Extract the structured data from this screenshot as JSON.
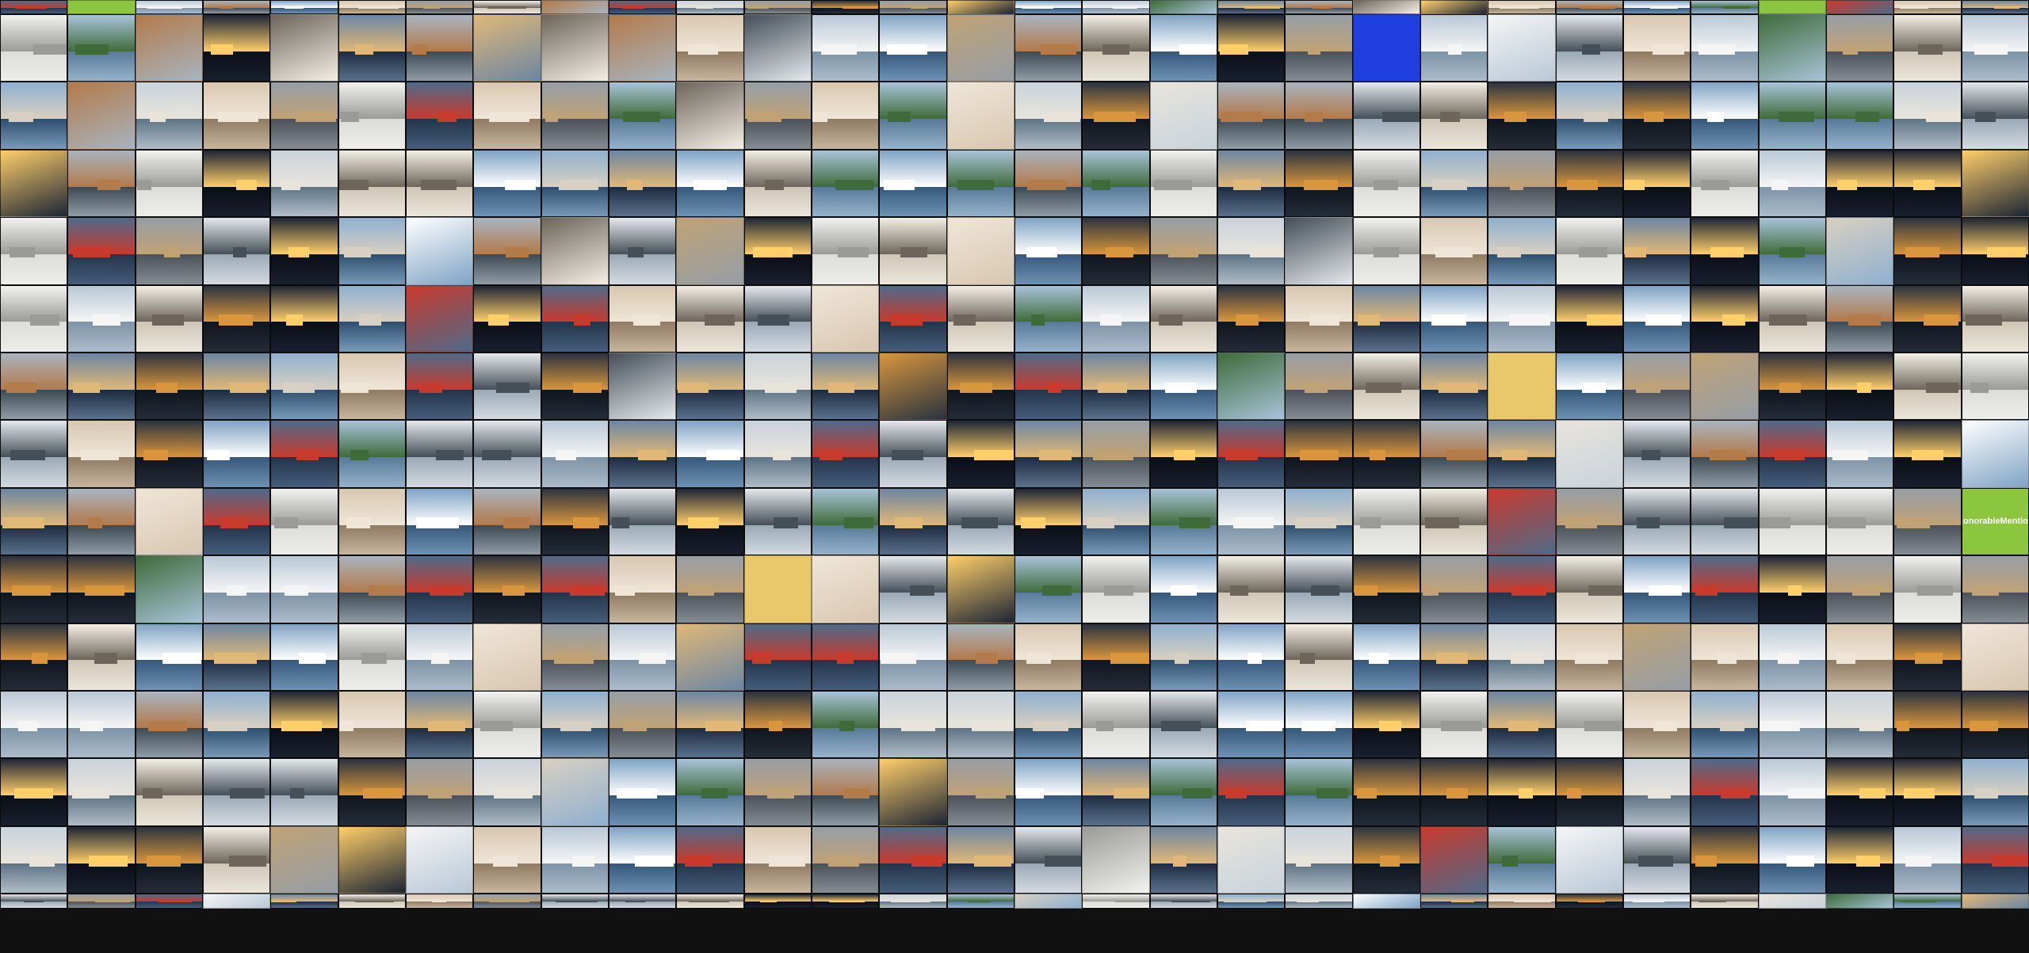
{
  "mosaic": {
    "columns": 30,
    "rows": 15,
    "palettes": [
      [
        "#c9d3dc",
        "#5d7384",
        "#e8e4dc"
      ],
      [
        "#8fb0cf",
        "#2d4f6d",
        "#d8d0c2"
      ],
      [
        "#a8b4bf",
        "#3e4a52",
        "#b37a4a"
      ],
      [
        "#f2f2f0",
        "#dcdcd8",
        "#9a9a96"
      ],
      [
        "#6c86a3",
        "#1c2b3f",
        "#e0b878"
      ],
      [
        "#2a3340",
        "#0f151d",
        "#d9963c"
      ],
      [
        "#b9c8d6",
        "#7d93a6",
        "#f5f5f5"
      ],
      [
        "#d8c7b0",
        "#8f7a62",
        "#efe6d8"
      ],
      [
        "#4f6a89",
        "#233449",
        "#c83a2c"
      ],
      [
        "#e5e9ed",
        "#9aa9b6",
        "#454f58"
      ],
      [
        "#7fa3c4",
        "#35587a",
        "#ffffff"
      ],
      [
        "#969ea6",
        "#4a5158",
        "#c0a276"
      ],
      [
        "#f4efe6",
        "#cfc6b5",
        "#6d655a"
      ],
      [
        "#1d2535",
        "#0a0e16",
        "#ffcf6a"
      ],
      [
        "#a9c3d9",
        "#577a98",
        "#3f6b3a"
      ]
    ],
    "honorable_mention": {
      "row": 8,
      "col": 29,
      "text_line1": "Honorable",
      "text_line2": "Mention"
    },
    "accent_tiles": [
      {
        "row": 0,
        "col": 1,
        "color": "#8cc63f"
      },
      {
        "row": 0,
        "col": 26,
        "color": "#8cc63f"
      },
      {
        "row": 1,
        "col": 20,
        "color": "#1f3fe0"
      },
      {
        "row": 6,
        "col": 22,
        "color": "#e8c86a"
      },
      {
        "row": 9,
        "col": 11,
        "color": "#e8c86a"
      }
    ]
  }
}
